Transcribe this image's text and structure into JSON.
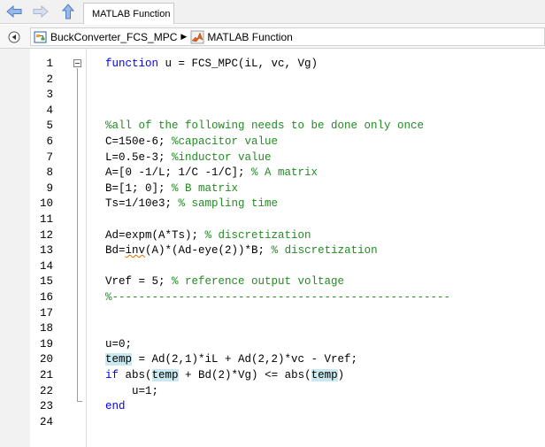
{
  "toolbar": {
    "back_icon": "back-arrow-icon",
    "forward_icon": "forward-arrow-icon",
    "up_icon": "up-arrow-icon",
    "tab_label": "MATLAB Function"
  },
  "address_bar": {
    "breadcrumbs": [
      {
        "label": "BuckConverter_FCS_MPC",
        "icon": "simulink-model-icon"
      },
      {
        "label": "MATLAB Function",
        "icon": "matlab-function-icon"
      }
    ]
  },
  "editor": {
    "lines": [
      {
        "n": "1",
        "code": "function u = FCS_MPC(iL, vc, Vg)"
      },
      {
        "n": "2",
        "code": ""
      },
      {
        "n": "3",
        "code": ""
      },
      {
        "n": "4",
        "code": ""
      },
      {
        "n": "5",
        "code": "%all of the following needs to be done only once"
      },
      {
        "n": "6",
        "code": "C=150e-6; %capacitor value"
      },
      {
        "n": "7",
        "code": "L=0.5e-3; %inductor value"
      },
      {
        "n": "8",
        "code": "A=[0 -1/L; 1/C -1/C]; % A matrix"
      },
      {
        "n": "9",
        "code": "B=[1; 0]; % B matrix"
      },
      {
        "n": "10",
        "code": "Ts=1/10e3; % sampling time"
      },
      {
        "n": "11",
        "code": ""
      },
      {
        "n": "12",
        "code": "Ad=expm(A*Ts); % discretization"
      },
      {
        "n": "13",
        "code": "Bd=inv(A)*(Ad-eye(2))*B; % discretization"
      },
      {
        "n": "14",
        "code": ""
      },
      {
        "n": "15",
        "code": "Vref = 5; % reference output voltage"
      },
      {
        "n": "16",
        "code": "%---------------------------------------------------"
      },
      {
        "n": "17",
        "code": ""
      },
      {
        "n": "18",
        "code": ""
      },
      {
        "n": "19",
        "code": "u=0;"
      },
      {
        "n": "20",
        "code": "temp = Ad(2,1)*iL + Ad(2,2)*vc - Vref;"
      },
      {
        "n": "21",
        "code": "if abs(temp + Bd(2)*Vg) <= abs(temp)"
      },
      {
        "n": "22",
        "code": "    u=1;"
      },
      {
        "n": "23",
        "code": "end"
      },
      {
        "n": "24",
        "code": ""
      }
    ],
    "colors": {
      "keyword": "#0000ff",
      "comment": "#228b22",
      "highlight": "#c9e8ef",
      "warning_underline": "#e07000"
    }
  }
}
